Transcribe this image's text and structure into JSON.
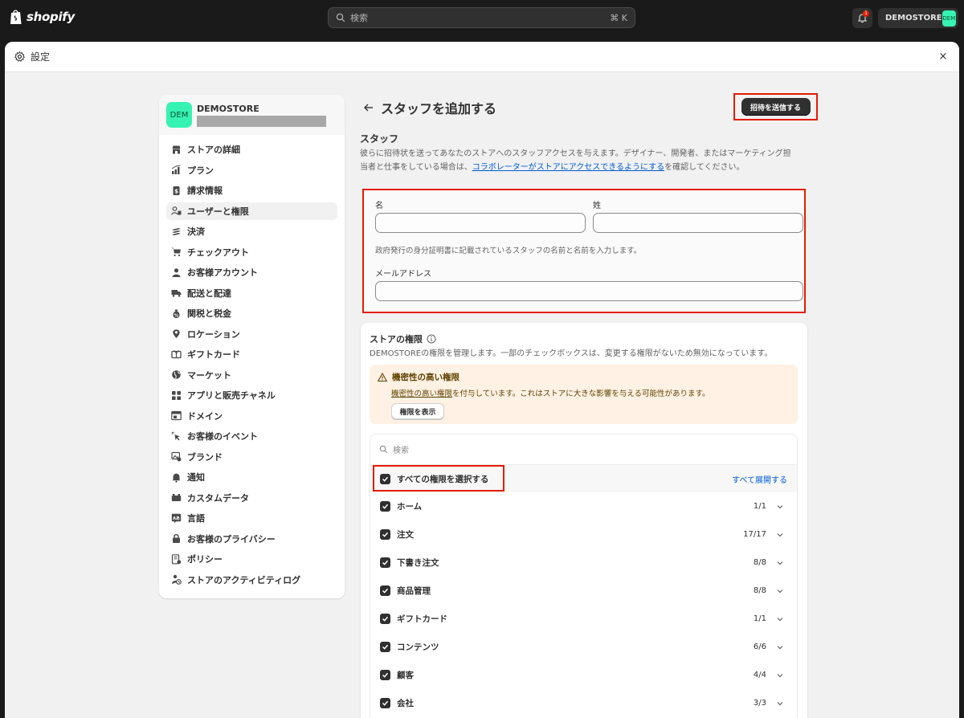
{
  "topbar": {
    "logo_text": "shopify",
    "search_placeholder": "検索",
    "search_shortcut": "⌘ K",
    "notification_count": "1",
    "store_label": "DEMOSTORE",
    "store_avatar": "DEM"
  },
  "modal": {
    "title": "設定",
    "close_label": "×"
  },
  "sidebar": {
    "store_avatar": "DEM",
    "store_name": "DEMOSTORE",
    "items": [
      {
        "label": "ストアの詳細",
        "icon": "store-icon"
      },
      {
        "label": "プラン",
        "icon": "plan-icon"
      },
      {
        "label": "請求情報",
        "icon": "billing-icon"
      },
      {
        "label": "ユーザーと権限",
        "icon": "users-icon",
        "active": true
      },
      {
        "label": "決済",
        "icon": "payments-icon"
      },
      {
        "label": "チェックアウト",
        "icon": "cart-icon"
      },
      {
        "label": "お客様アカウント",
        "icon": "person-icon"
      },
      {
        "label": "配送と配達",
        "icon": "truck-icon"
      },
      {
        "label": "関税と税金",
        "icon": "tax-icon"
      },
      {
        "label": "ロケーション",
        "icon": "location-icon"
      },
      {
        "label": "ギフトカード",
        "icon": "gift-card-icon"
      },
      {
        "label": "マーケット",
        "icon": "globe-icon"
      },
      {
        "label": "アプリと販売チャネル",
        "icon": "apps-icon"
      },
      {
        "label": "ドメイン",
        "icon": "domain-icon"
      },
      {
        "label": "お客様のイベント",
        "icon": "cursor-icon"
      },
      {
        "label": "ブランド",
        "icon": "brand-icon"
      },
      {
        "label": "通知",
        "icon": "bell-icon"
      },
      {
        "label": "カスタムデータ",
        "icon": "data-icon"
      },
      {
        "label": "言語",
        "icon": "language-icon"
      },
      {
        "label": "お客様のプライバシー",
        "icon": "lock-icon"
      },
      {
        "label": "ポリシー",
        "icon": "policy-icon"
      },
      {
        "label": "ストアのアクティビティログ",
        "icon": "activity-icon"
      }
    ]
  },
  "main": {
    "title": "スタッフを追加する",
    "send_button": "招待を送信する",
    "staff_heading": "スタッフ",
    "staff_desc_before": "彼らに招待状を送ってあなたのストアへのスタッフアクセスを与えます。デザイナー、開発者、またはマーケティング担当者と仕事をしている場合は、",
    "staff_desc_link": "コラボレーターがストアにアクセスできるようにする",
    "staff_desc_after": "を確認してください。",
    "form": {
      "first_name_label": "名",
      "first_name_value": "",
      "last_name_label": "姓",
      "last_name_value": "",
      "name_help": "政府発行の身分証明書に記載されているスタッフの名前と名前を入力します。",
      "email_label": "メールアドレス",
      "email_value": ""
    },
    "permissions": {
      "heading": "ストアの権限",
      "desc": "DEMOSTOREの権限を管理します。一部のチェックボックスは、変更する権限がないため無効になっています。",
      "warning_title": "機密性の高い権限",
      "warning_link": "機密性の高い権限",
      "warning_text": "を付与しています。これはストアに大きな影響を与える可能性があります。",
      "warning_button": "権限を表示",
      "search_placeholder": "検索",
      "select_all": "すべての権限を選択する",
      "expand_all": "すべて展開する",
      "rows": [
        {
          "label": "ホーム",
          "count": "1/1"
        },
        {
          "label": "注文",
          "count": "17/17"
        },
        {
          "label": "下書き注文",
          "count": "8/8"
        },
        {
          "label": "商品管理",
          "count": "8/8"
        },
        {
          "label": "ギフトカード",
          "count": "1/1"
        },
        {
          "label": "コンテンツ",
          "count": "6/6"
        },
        {
          "label": "顧客",
          "count": "4/4"
        },
        {
          "label": "会社",
          "count": "3/3"
        }
      ]
    }
  },
  "colors": {
    "accent": "#303030",
    "highlight": "#e51c00",
    "link": "#005bd3",
    "avatar": "#36f3b3",
    "warning_bg": "#fff1e3"
  }
}
